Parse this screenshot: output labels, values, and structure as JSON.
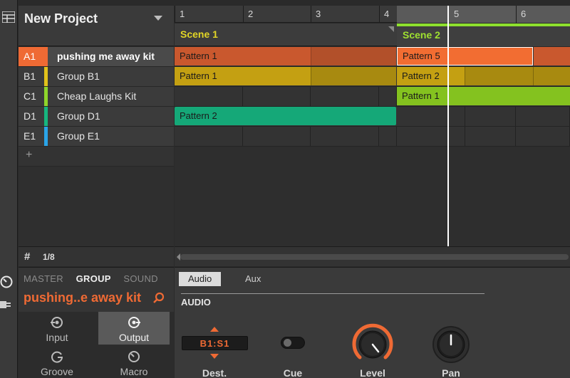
{
  "project": {
    "title": "New Project",
    "page_count": "1/8"
  },
  "groups": [
    {
      "id": "A1",
      "name": "pushing me away kit",
      "color": "#ef6a34",
      "selected": true
    },
    {
      "id": "B1",
      "name": "Group B1",
      "color": "#e2c21a",
      "selected": false
    },
    {
      "id": "C1",
      "name": "Cheap Laughs Kit",
      "color": "#8fd62a",
      "selected": false
    },
    {
      "id": "D1",
      "name": "Group D1",
      "color": "#16b67f",
      "selected": false
    },
    {
      "id": "E1",
      "name": "Group E1",
      "color": "#2aa4e8",
      "selected": false
    }
  ],
  "add_group_symbol": "+",
  "ruler": {
    "bars": [
      "1",
      "2",
      "3",
      "4",
      "5",
      "6"
    ]
  },
  "scenes": [
    {
      "name": "Scene 1",
      "color": "#e2d626"
    },
    {
      "name": "Scene 2",
      "color": "#9fe030"
    }
  ],
  "clips": {
    "a1_scene1": "Pattern 1",
    "a1_scene2": "Pattern 5",
    "b1_scene1": "Pattern 1",
    "b1_scene2": "Pattern 2",
    "c1_scene2": "Pattern 1",
    "d1_scene1": "Pattern 2"
  },
  "colors": {
    "accent": "#ef6a34",
    "group_a_clip": "#c9582e",
    "group_a_clip_dark": "#b2502a",
    "group_a_selected_clip": "#f26d32",
    "group_b_clip": "#c4a012",
    "group_b_clip_dark": "#a88a10",
    "group_c_clip": "#84c21f",
    "group_d_clip": "#15a878"
  },
  "control": {
    "tabs": [
      "MASTER",
      "GROUP",
      "SOUND"
    ],
    "active_tab": "GROUP",
    "current_name": "pushing..e away kit",
    "buttons": [
      {
        "label": "Input",
        "icon": "input-icon",
        "active": false
      },
      {
        "label": "Output",
        "icon": "output-icon",
        "active": true
      },
      {
        "label": "Groove",
        "icon": "groove-icon",
        "active": false
      },
      {
        "label": "Macro",
        "icon": "macro-icon",
        "active": false
      }
    ]
  },
  "audio_panel": {
    "tabs": [
      "Audio",
      "Aux"
    ],
    "active_tab": "Audio",
    "section": "AUDIO",
    "dest_value": "B1:S1",
    "labels": {
      "dest": "Dest.",
      "cue": "Cue",
      "level": "Level",
      "pan": "Pan"
    },
    "cue_on": false
  }
}
